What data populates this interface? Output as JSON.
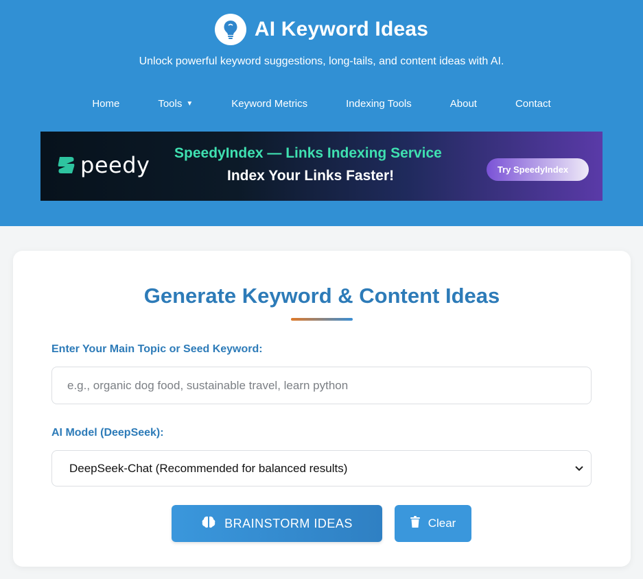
{
  "header": {
    "title": "AI Keyword Ideas",
    "tagline": "Unlock powerful keyword suggestions, long-tails, and content ideas with AI.",
    "logo_icon": "lightbulb-icon",
    "background_color": "#3190d4"
  },
  "nav": {
    "items": [
      {
        "label": "Home"
      },
      {
        "label": "Tools"
      },
      {
        "label": "Keyword Metrics"
      },
      {
        "label": "Indexing Tools"
      },
      {
        "label": "About"
      },
      {
        "label": "Contact"
      }
    ]
  },
  "banner": {
    "logo_text": "peedy",
    "headline": "SpeedyIndex — Links Indexing Service",
    "subheadline": "Index Your Links Faster!",
    "cta_label": "Try SpeedyIndex"
  },
  "form": {
    "title": "Generate Keyword & Content Ideas",
    "topic_label": "Enter Your Main Topic or Seed Keyword:",
    "topic_placeholder": "e.g., organic dog food, sustainable travel, learn python",
    "topic_value": "",
    "model_label": "AI Model (DeepSeek):",
    "model_selected": "DeepSeek-Chat (Recommended for balanced results)",
    "brainstorm_label": "BRAINSTORM IDEAS",
    "clear_label": "Clear",
    "accent_color": "#2d7bb8"
  }
}
